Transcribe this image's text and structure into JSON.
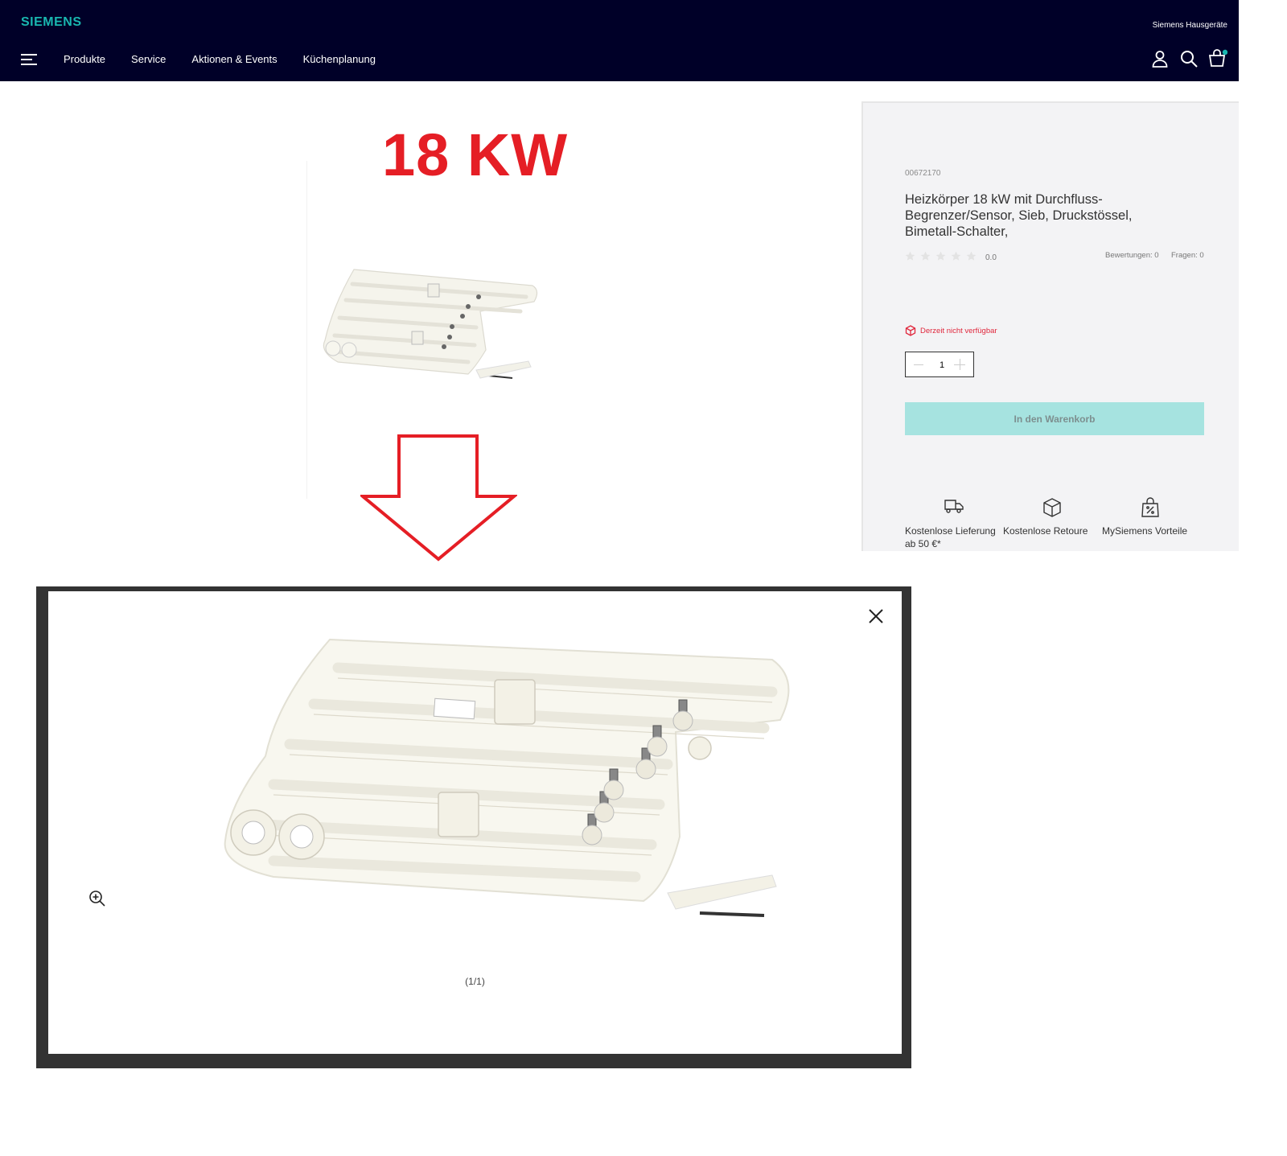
{
  "header": {
    "logo": "SIEMENS",
    "brand_link": "Siemens Hausgeräte",
    "nav": [
      "Produkte",
      "Service",
      "Aktionen & Events",
      "Küchenplanung"
    ],
    "icons": [
      "menu-icon",
      "user-icon",
      "search-icon",
      "cart-icon"
    ],
    "cart_count": "0"
  },
  "annotation": {
    "label": "18 KW",
    "color": "#e51e25"
  },
  "product": {
    "sku": "00672170",
    "title": "Heizkörper  18 kW mit Durchfluss-Begrenzer/Sensor, Sieb,  Druckstössel, Bimetall-Schalter,",
    "rating": "0.0",
    "reviews": "Bewertungen: 0",
    "questions": "Fragen: 0",
    "availability": "Derzeit nicht verfügbar",
    "quantity": "1",
    "add_to_cart": "In den Warenkorb",
    "usps": [
      {
        "icon": "truck-icon",
        "label": "Kostenlose Lieferung ab 50 €*"
      },
      {
        "icon": "box-icon",
        "label": "Kostenlose Retoure"
      },
      {
        "icon": "shopping-bag-percent-icon",
        "label": "MySiemens Vorteile"
      }
    ]
  },
  "lightbox": {
    "counter": "(1/1)"
  },
  "colors": {
    "header_bg": "#000028",
    "brand_teal": "#19b7b0",
    "button_bg": "#a6e3e0",
    "alert_red": "#e0273c"
  }
}
